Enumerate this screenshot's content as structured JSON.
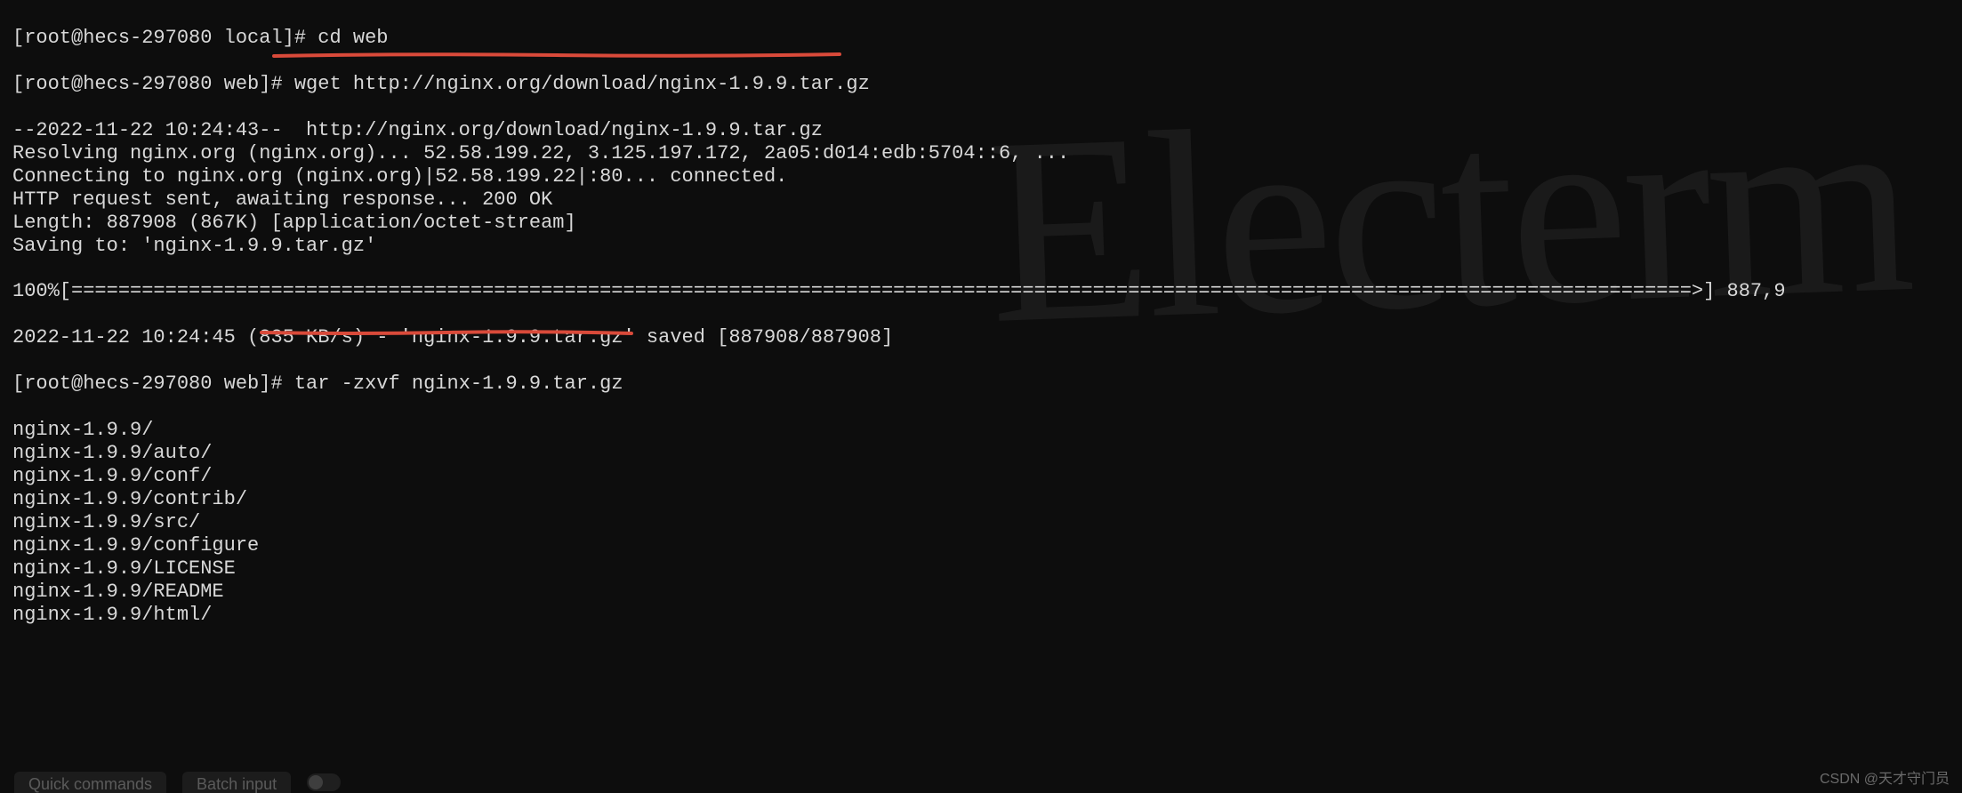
{
  "prompts": {
    "p1_prefix": "[root@hecs-297080 local]# ",
    "p1_cmd": "cd web",
    "p2_prefix": "[root@hecs-297080 web]# ",
    "p2_cmd": "wget http://nginx.org/download/nginx-1.9.9.tar.gz",
    "p3_prefix": "[root@hecs-297080 web]# ",
    "p3_cmd": "tar -zxvf nginx-1.9.9.tar.gz"
  },
  "wget": {
    "l1": "--2022-11-22 10:24:43--  http://nginx.org/download/nginx-1.9.9.tar.gz",
    "l2": "Resolving nginx.org (nginx.org)... 52.58.199.22, 3.125.197.172, 2a05:d014:edb:5704::6, ...",
    "l3": "Connecting to nginx.org (nginx.org)|52.58.199.22|:80... connected.",
    "l4": "HTTP request sent, awaiting response... 200 OK",
    "l5": "Length: 887908 (867K) [application/octet-stream]",
    "l6": "Saving to: 'nginx-1.9.9.tar.gz'",
    "progress": "100%[==========================================================================================================================================>] 887,9",
    "done": "2022-11-22 10:24:45 (835 KB/s) - 'nginx-1.9.9.tar.gz' saved [887908/887908]"
  },
  "tar_output": [
    "nginx-1.9.9/",
    "nginx-1.9.9/auto/",
    "nginx-1.9.9/conf/",
    "nginx-1.9.9/contrib/",
    "nginx-1.9.9/src/",
    "nginx-1.9.9/configure",
    "nginx-1.9.9/LICENSE",
    "nginx-1.9.9/README",
    "nginx-1.9.9/html/"
  ],
  "watermark_text": "Electerm",
  "bottom": {
    "quick": "Quick commands",
    "batch": "Batch input"
  },
  "attribution": "CSDN @天才守门员",
  "colors": {
    "underline": "#d94a3a"
  }
}
